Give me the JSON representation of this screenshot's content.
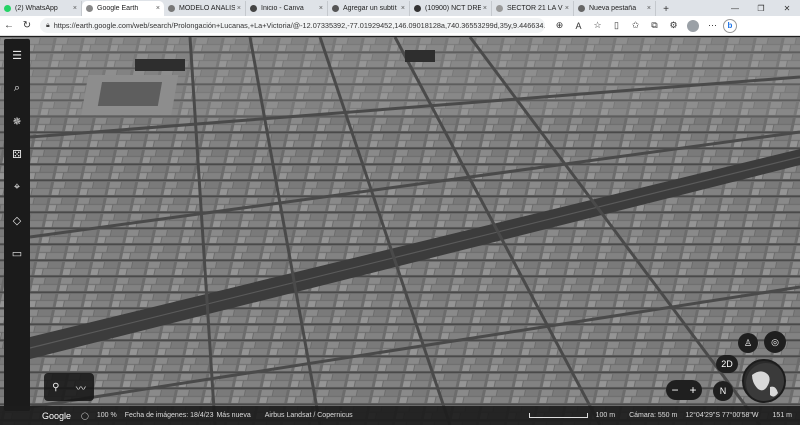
{
  "browser": {
    "tabs": [
      {
        "label": "(2) WhatsApp",
        "color": "#25d366",
        "active": false
      },
      {
        "label": "Google Earth",
        "color": "#888888",
        "active": true
      },
      {
        "label": "MODELO ANALISI",
        "color": "#777777",
        "active": false
      },
      {
        "label": "Inicio - Canva",
        "color": "#444444",
        "active": false
      },
      {
        "label": "Agregar un subtít",
        "color": "#555555",
        "active": false
      },
      {
        "label": "(10900) NCT DRE",
        "color": "#333333",
        "active": false
      },
      {
        "label": "SECTOR 21 LA VI",
        "color": "#999999",
        "active": false
      },
      {
        "label": "Nueva pestaña",
        "color": "#666666",
        "active": false
      }
    ],
    "new_tab": "+",
    "window_controls": {
      "minimize": "—",
      "maximize": "❐",
      "close": "✕"
    },
    "address": "https://earth.google.com/web/search/Prolongación+Lucanas,+La+Victoria/@-12.07335392,-77.01929452,146.09018128a,740.36553299d,35y,9.446634..."
  },
  "earth": {
    "sidebar_icons": [
      "menu-icon",
      "search-icon",
      "voyager-icon",
      "feeling-lucky-icon",
      "projects-icon",
      "map-style-icon",
      "measure-icon"
    ],
    "status": {
      "logo": "Google",
      "zoom_pct": "100 %",
      "imagery_date": "Fecha de imágenes: 18/4/23",
      "more": "Más nueva",
      "attribution": "Airbus   Landsat / Copernicus",
      "scale_label": "100 m",
      "camera": "Cámara: 550 m",
      "coords": "12°04'29\"S 77°00'58\"W",
      "elevation": "151 m"
    },
    "controls": {
      "view_2d": "2D",
      "zoom_minus": "−",
      "zoom_plus": "+",
      "compass": "N"
    }
  }
}
